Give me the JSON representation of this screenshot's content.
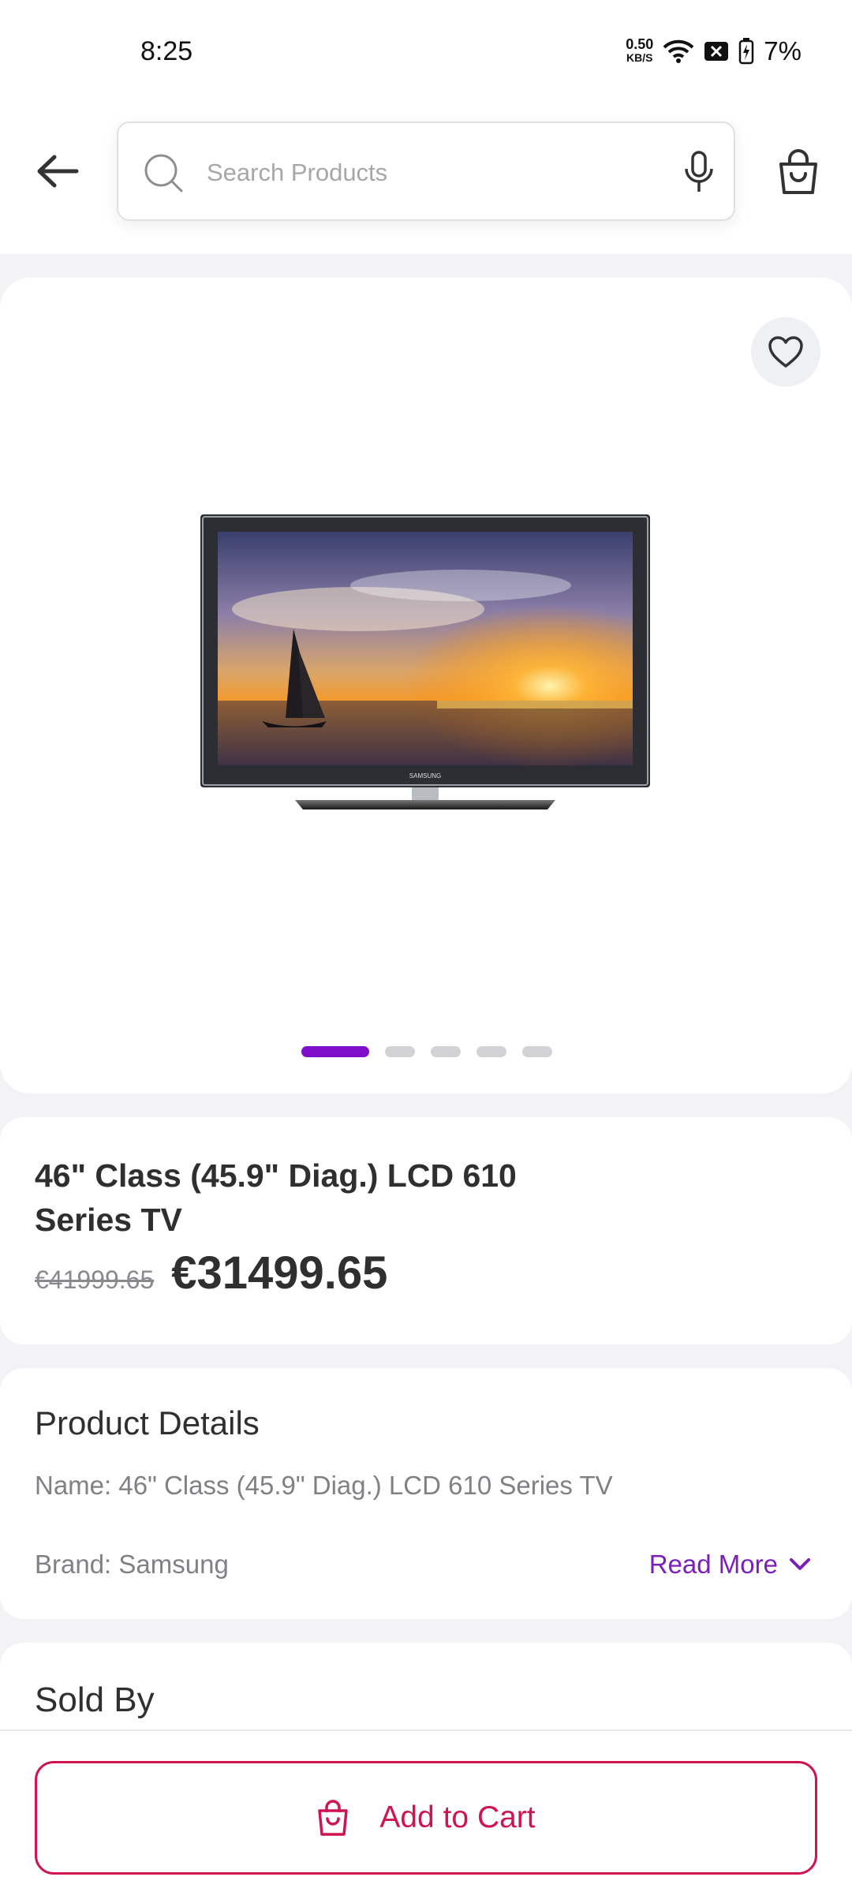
{
  "status_bar": {
    "time": "8:25",
    "net_speed_value": "0.50",
    "net_speed_unit": "KB/S",
    "battery_percent": "7%",
    "icons": [
      "wifi-icon",
      "sim-blocked-icon",
      "battery-charging-icon"
    ]
  },
  "header": {
    "back_icon": "arrow-left-icon",
    "search": {
      "placeholder": "Search Products",
      "value": ""
    },
    "icons": [
      "search-icon",
      "mic-icon",
      "shopping-bag-icon"
    ]
  },
  "gallery": {
    "favorite_icon": "heart-icon",
    "image_alt": "Samsung 46 inch LCD TV showing sailboat at sunset",
    "tv_brand_text": "SAMSUNG",
    "dots": [
      {
        "active": true
      },
      {
        "active": false
      },
      {
        "active": false
      },
      {
        "active": false
      },
      {
        "active": false
      }
    ]
  },
  "product": {
    "title": "46\" Class (45.9\" Diag.) LCD 610 Series TV",
    "old_price": "€41999.65",
    "price": "€31499.65"
  },
  "details": {
    "heading": "Product Details",
    "name_line": "Name: 46\" Class (45.9\" Diag.) LCD 610 Series TV",
    "brand_line": "Brand: Samsung",
    "read_more": "Read More"
  },
  "seller": {
    "heading": "Sold By"
  },
  "actions": {
    "add_to_cart": "Add to Cart"
  },
  "colors": {
    "accent_purple": "#7e0ec9",
    "cart_red": "#cf1450",
    "background": "#f3f3f5"
  }
}
